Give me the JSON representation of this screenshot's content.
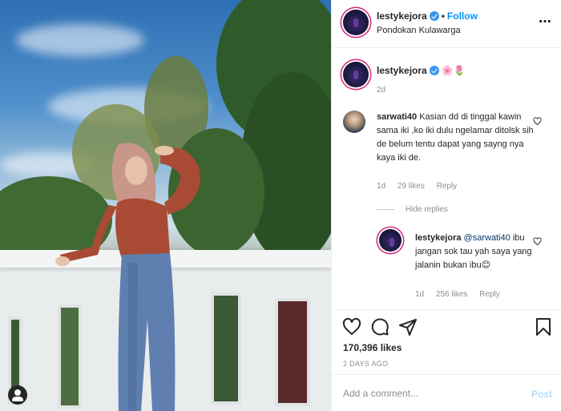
{
  "post": {
    "username": "lestykejora",
    "follow_label": "Follow",
    "separator": "•",
    "location": "Pondokan Kulawarga",
    "more_icon": "more-horizontal-icon"
  },
  "caption": {
    "username": "lestykejora",
    "emoji": "🌸🌷",
    "time": "2d"
  },
  "comment": {
    "username": "sarwati40",
    "text": "Kasian dd di tinggal kawin sama iki ,ko iki dulu ngelamar ditolsk sih de belum tentu dapat yang sayng nya kaya iki de.",
    "time": "1d",
    "likes": "29 likes",
    "reply_label": "Reply"
  },
  "hide_replies_label": "Hide replies",
  "reply": {
    "username": "lestykejora",
    "mention": "@sarwati40",
    "text": "ibu jangan sok tau yah saya yang jalanin bukan ibu",
    "emoji": "😊",
    "time": "1d",
    "likes": "256 likes",
    "reply_label": "Reply"
  },
  "actions": {
    "like_icon": "heart-icon",
    "comment_icon": "comment-icon",
    "share_icon": "share-icon",
    "save_icon": "bookmark-icon",
    "likes_count": "170,396 likes",
    "date": "2 DAYS AGO"
  },
  "add_comment": {
    "placeholder": "Add a comment...",
    "post_label": "Post"
  },
  "colors": {
    "accent": "#0095f6",
    "verified": "#3897f0",
    "muted": "#8e8e8e",
    "post_disabled": "#b2dffc"
  }
}
